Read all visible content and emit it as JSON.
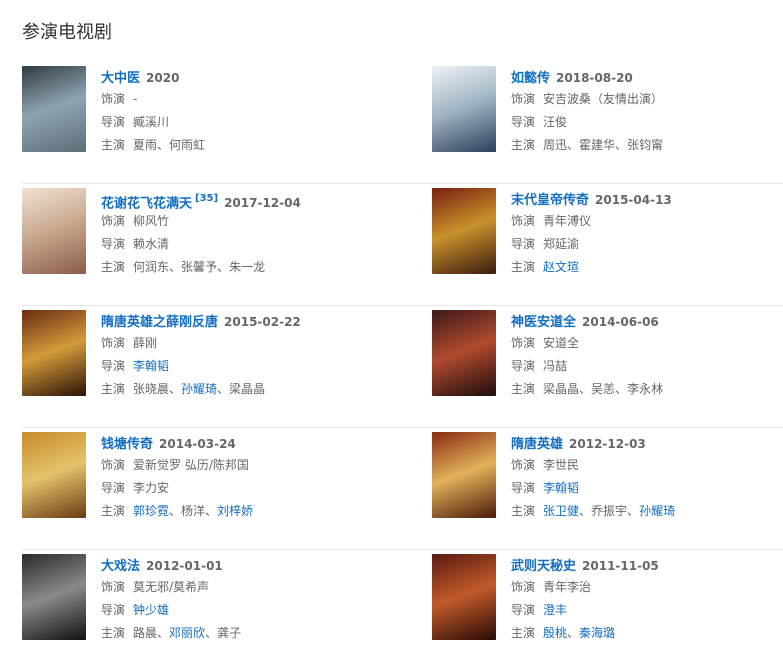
{
  "section": {
    "title": "参演电视剧"
  },
  "labels": {
    "role": "饰演",
    "director": "导演",
    "cast": "主演",
    "sep": "、"
  },
  "shows": [
    {
      "title": "大中医",
      "year": "2020",
      "ref": "",
      "role": [
        {
          "t": "-",
          "link": false
        }
      ],
      "director": [
        {
          "t": "臧溪川",
          "link": false
        }
      ],
      "cast": [
        {
          "t": "夏雨",
          "link": false
        },
        {
          "t": "何雨虹",
          "link": false
        }
      ],
      "colors": [
        "#2e3b45",
        "#8fa3b0",
        "#5c6d78"
      ]
    },
    {
      "title": "如懿传",
      "year": "2018-08-20",
      "ref": "",
      "role": [
        {
          "t": "安吉波桑（友情出演）",
          "link": false
        }
      ],
      "director": [
        {
          "t": "汪俊",
          "link": false
        }
      ],
      "cast": [
        {
          "t": "周迅",
          "link": false
        },
        {
          "t": "霍建华",
          "link": false
        },
        {
          "t": "张钧甯",
          "link": false
        }
      ],
      "colors": [
        "#eef2f5",
        "#9fb4c3",
        "#2e3e5c"
      ]
    },
    {
      "title": "花谢花飞花满天",
      "year": "2017-12-04",
      "ref": "[35]",
      "role": [
        {
          "t": "柳风竹",
          "link": false
        }
      ],
      "director": [
        {
          "t": "赖水清",
          "link": false
        }
      ],
      "cast": [
        {
          "t": "何润东",
          "link": false
        },
        {
          "t": "张馨予",
          "link": false
        },
        {
          "t": "朱一龙",
          "link": false
        }
      ],
      "colors": [
        "#f1e2d2",
        "#c9a890",
        "#8a5c4a"
      ]
    },
    {
      "title": "末代皇帝传奇",
      "year": "2015-04-13",
      "ref": "",
      "role": [
        {
          "t": "青年溥仪",
          "link": false
        }
      ],
      "director": [
        {
          "t": "郑延渝",
          "link": false
        }
      ],
      "cast": [
        {
          "t": "赵文瑄",
          "link": true
        }
      ],
      "colors": [
        "#7a1f10",
        "#c9922b",
        "#3a1a10"
      ]
    },
    {
      "title": "隋唐英雄之薛刚反唐",
      "year": "2015-02-22",
      "ref": "",
      "role": [
        {
          "t": "薛刚",
          "link": false
        }
      ],
      "director": [
        {
          "t": "李翰韬",
          "link": true
        }
      ],
      "cast": [
        {
          "t": "张晓晨",
          "link": false
        },
        {
          "t": "孙耀琦",
          "link": true
        },
        {
          "t": "梁晶晶",
          "link": false
        }
      ],
      "colors": [
        "#6b2a12",
        "#d49b3a",
        "#2a1208"
      ]
    },
    {
      "title": "神医安道全",
      "year": "2014-06-06",
      "ref": "",
      "role": [
        {
          "t": "安道全",
          "link": false
        }
      ],
      "director": [
        {
          "t": "冯喆",
          "link": false
        }
      ],
      "cast": [
        {
          "t": "梁晶晶",
          "link": false
        },
        {
          "t": "吴恙",
          "link": false
        },
        {
          "t": "李永林",
          "link": false
        }
      ],
      "colors": [
        "#3d1a1a",
        "#b24a2f",
        "#1e0d0d"
      ]
    },
    {
      "title": "钱塘传奇",
      "year": "2014-03-24",
      "ref": "",
      "role": [
        {
          "t": "爱新觉罗 弘历/陈邦国",
          "link": false
        }
      ],
      "director": [
        {
          "t": "李力安",
          "link": false
        }
      ],
      "cast": [
        {
          "t": "郭珍霓",
          "link": true
        },
        {
          "t": "杨洋",
          "link": false
        },
        {
          "t": "刘梓娇",
          "link": true
        }
      ],
      "colors": [
        "#c88a2a",
        "#e3c36b",
        "#6b3a12"
      ]
    },
    {
      "title": "隋唐英雄",
      "year": "2012-12-03",
      "ref": "",
      "role": [
        {
          "t": "李世民",
          "link": false
        }
      ],
      "director": [
        {
          "t": "李翰韬",
          "link": true
        }
      ],
      "cast": [
        {
          "t": "张卫健",
          "link": true
        },
        {
          "t": "乔振宇",
          "link": false
        },
        {
          "t": "孙耀琦",
          "link": true
        }
      ],
      "colors": [
        "#8a2a12",
        "#e2b25a",
        "#4a1a0a"
      ]
    },
    {
      "title": "大戏法",
      "year": "2012-01-01",
      "ref": "",
      "role": [
        {
          "t": "莫无邪/莫希声",
          "link": false
        }
      ],
      "director": [
        {
          "t": "钟少雄",
          "link": true
        }
      ],
      "cast": [
        {
          "t": "路晨",
          "link": false
        },
        {
          "t": "邓丽欣",
          "link": true
        },
        {
          "t": "龚子",
          "link": false
        }
      ],
      "colors": [
        "#2a2a2a",
        "#8a8a8a",
        "#111111"
      ]
    },
    {
      "title": "武则天秘史",
      "year": "2011-11-05",
      "ref": "",
      "role": [
        {
          "t": "青年李治",
          "link": false
        }
      ],
      "director": [
        {
          "t": "澄丰",
          "link": true
        }
      ],
      "cast": [
        {
          "t": "殷桃",
          "link": true
        },
        {
          "t": "秦海璐",
          "link": true
        }
      ],
      "colors": [
        "#5a1a12",
        "#c25a2a",
        "#2a0a06"
      ]
    }
  ]
}
